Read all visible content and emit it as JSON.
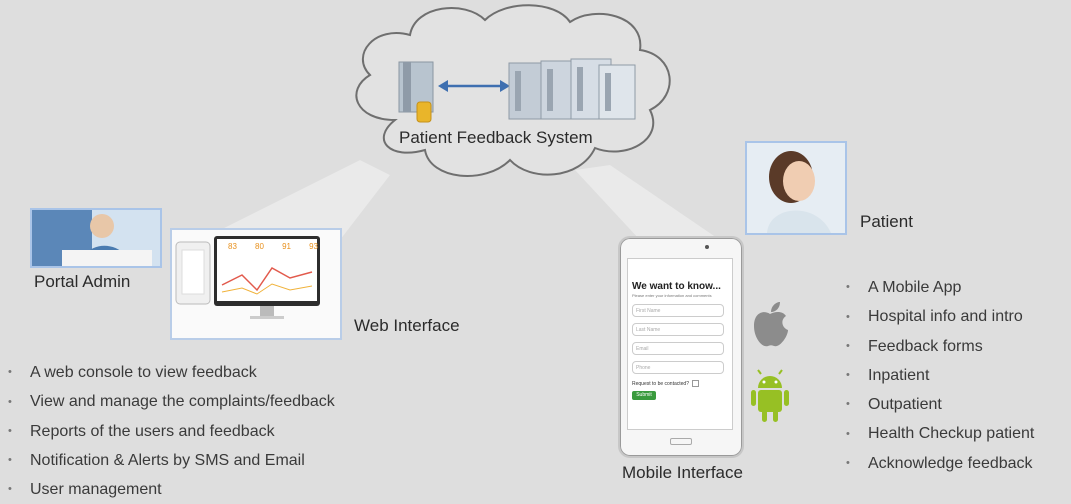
{
  "cloud": {
    "label": "Patient Feedback System"
  },
  "portal_admin": {
    "label": "Portal Admin"
  },
  "web_interface": {
    "label": "Web Interface",
    "bullets": [
      "A web console to view feedback",
      "View and manage the complaints/feedback",
      "Reports of the users and feedback",
      "Notification & Alerts by SMS and Email",
      "User management"
    ]
  },
  "patient": {
    "label": "Patient",
    "bullets": [
      "A Mobile App",
      "Hospital info and intro",
      "Feedback forms",
      "Inpatient",
      "Outpatient",
      "Health Checkup patient",
      "Acknowledge feedback"
    ]
  },
  "mobile_interface": {
    "label": "Mobile Interface",
    "form_title": "We want to know...",
    "form_subtitle": "Please enter your information and comments",
    "fields": [
      "First Name",
      "Last Name",
      "Email",
      "Phone"
    ],
    "checkbox_label": "Request to be contacted?",
    "submit_label": "Submit"
  },
  "dashboard": {
    "stats": [
      "83",
      "80",
      "91",
      "93"
    ]
  },
  "colors": {
    "background": "#dedede",
    "accent_blue": "#3e6fb0",
    "submit_green": "#3a9b3e",
    "android_green": "#97c024"
  }
}
